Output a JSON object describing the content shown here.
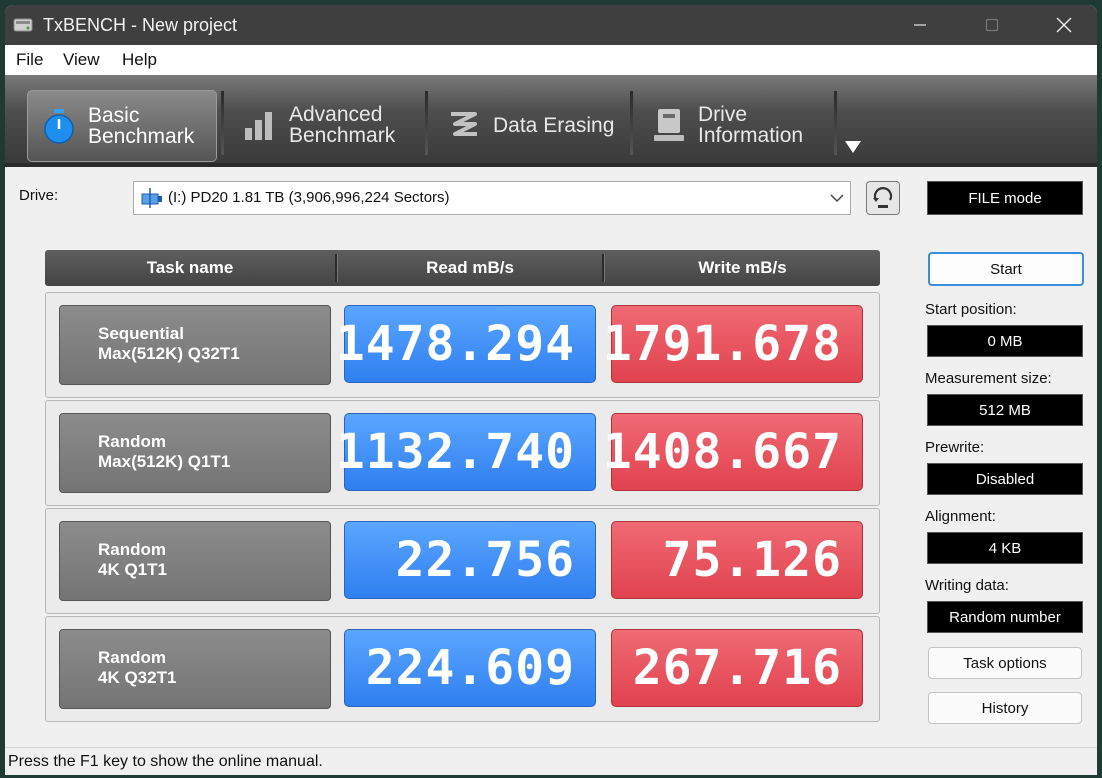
{
  "window": {
    "title": "TxBENCH - New project",
    "icons": {
      "app": "drive-app-icon",
      "minimize": "minimize-icon",
      "maximize": "maximize-icon",
      "close": "close-icon"
    }
  },
  "menu": {
    "file": "File",
    "view": "View",
    "help": "Help"
  },
  "toolbar": {
    "tabs": [
      {
        "label": "Basic\nBenchmark",
        "icon": "stopwatch-icon",
        "active": true
      },
      {
        "label": "Advanced\nBenchmark",
        "icon": "bar-chart-icon",
        "active": false
      },
      {
        "label": "Data Erasing",
        "icon": "erase-icon",
        "active": false
      },
      {
        "label": "Drive\nInformation",
        "icon": "drive-info-icon",
        "active": false
      }
    ],
    "more_icon": "dropdown-arrow-icon"
  },
  "drive": {
    "label": "Drive:",
    "selected": "(I:) PD20  1.81 TB (3,906,996,224 Sectors)",
    "mode": "FILE mode"
  },
  "table": {
    "headers": {
      "task": "Task name",
      "read": "Read mB/s",
      "write": "Write mB/s"
    },
    "rows": [
      {
        "line1": "Sequential",
        "line2": "Max(512K) Q32T1",
        "read": "1478.294",
        "write": "1791.678"
      },
      {
        "line1": "Random",
        "line2": "Max(512K) Q1T1",
        "read": "1132.740",
        "write": "1408.667"
      },
      {
        "line1": "Random",
        "line2": "4K Q1T1",
        "read": "22.756",
        "write": "75.126"
      },
      {
        "line1": "Random",
        "line2": "4K Q32T1",
        "read": "224.609",
        "write": "267.716"
      }
    ]
  },
  "side": {
    "start": "Start",
    "start_position_label": "Start position:",
    "start_position": "0 MB",
    "measurement_label": "Measurement size:",
    "measurement": "512 MB",
    "prewrite_label": "Prewrite:",
    "prewrite": "Disabled",
    "alignment_label": "Alignment:",
    "alignment": "4 KB",
    "writing_label": "Writing data:",
    "writing": "Random number",
    "task_options": "Task options",
    "history": "History"
  },
  "status": "Press the F1 key to show the online manual.",
  "colors": {
    "read": "#3a8cf6",
    "write": "#e84d59",
    "toolbar": "#4e4e4e"
  }
}
